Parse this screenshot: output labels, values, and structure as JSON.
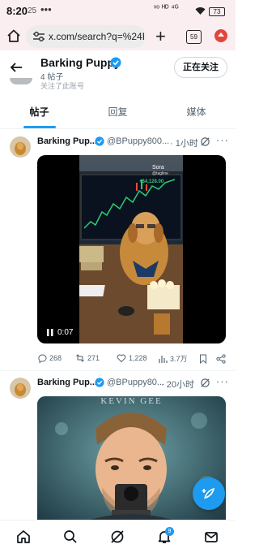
{
  "status_bar": {
    "time": "8:20",
    "mini_icon": "25",
    "dots": "•••",
    "signal_text": "ᵛᵒ ᴴᴰ ⁴ᴳ",
    "battery": "73"
  },
  "browser": {
    "url": "x.com/search?q=%24B",
    "tab_count": "59",
    "icons": [
      "home-icon",
      "tune-icon",
      "plus-icon",
      "tabs-icon",
      "record-icon"
    ]
  },
  "profile": {
    "name": "Barking Puppy",
    "post_count": "4 帖子",
    "follow_label": "正在关注",
    "peek_text": "关注了此账号"
  },
  "tabs": [
    {
      "label": "帖子",
      "active": true
    },
    {
      "label": "回复",
      "active": false
    },
    {
      "label": "媒体",
      "active": false
    }
  ],
  "posts": [
    {
      "author": "Barking Pup...",
      "handle": "@BPuppy800...",
      "time": "· 1小时",
      "more": "···",
      "media": {
        "type": "video",
        "watermark": "Sora",
        "watermark_sub": "@tagline",
        "ticker": "+$4,128.00",
        "duration": "0:07"
      },
      "stats": {
        "replies": "268",
        "reposts": "271",
        "likes": "1,228",
        "views": "3.7万"
      }
    },
    {
      "author": "Barking Pup...",
      "handle": "@BPuppy80...",
      "time": "· 20小时",
      "more": "···",
      "media": {
        "type": "image",
        "caption": "KEVIN GEE"
      }
    }
  ],
  "nav": {
    "items": [
      "home-icon",
      "search-icon",
      "grok-icon",
      "notifications-icon",
      "messages-icon"
    ],
    "notification_badge": "9"
  },
  "colors": {
    "accent": "#1d9bf0",
    "status_bg": "#fbeef0",
    "text": "#0f1419",
    "muted": "#536471"
  }
}
